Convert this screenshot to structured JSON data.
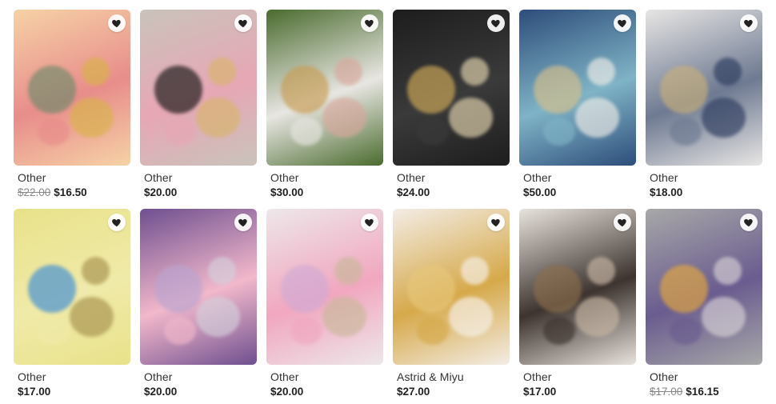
{
  "listings": [
    {
      "brand": "Other",
      "original_price": "$22.00",
      "price": "$16.50",
      "colors": [
        "#f6d2a6",
        "#e88d8b",
        "#6e8a6a",
        "#d8b34a"
      ]
    },
    {
      "brand": "Other",
      "original_price": "",
      "price": "$20.00",
      "colors": [
        "#c9c3bb",
        "#e7a7b5",
        "#141414",
        "#d8b56b"
      ]
    },
    {
      "brand": "Other",
      "original_price": "",
      "price": "$30.00",
      "colors": [
        "#4a6b2e",
        "#e8e6e2",
        "#c79b52",
        "#d8a79c"
      ]
    },
    {
      "brand": "Other",
      "original_price": "",
      "price": "$24.00",
      "colors": [
        "#1d1d1d",
        "#3a3a3a",
        "#d3ad5a",
        "#e6d7b2"
      ]
    },
    {
      "brand": "Other",
      "original_price": "",
      "price": "$50.00",
      "colors": [
        "#2d4d7a",
        "#7fb3c6",
        "#d9c08b",
        "#f1eee8"
      ]
    },
    {
      "brand": "Other",
      "original_price": "",
      "price": "$18.00",
      "colors": [
        "#e8e6e4",
        "#6e7a92",
        "#c8b07c",
        "#2c3b5e"
      ]
    },
    {
      "brand": "Other",
      "original_price": "",
      "price": "$17.00",
      "colors": [
        "#e8e28a",
        "#f0eaa9",
        "#3c8cd6",
        "#a6914e"
      ]
    },
    {
      "brand": "Other",
      "original_price": "",
      "price": "$20.00",
      "colors": [
        "#6e4f8f",
        "#f2b8cb",
        "#b9a4cf",
        "#d5d0dc"
      ]
    },
    {
      "brand": "Other",
      "original_price": "",
      "price": "$20.00",
      "colors": [
        "#ede7ea",
        "#f1a7bf",
        "#d0aad4",
        "#c9b89a"
      ]
    },
    {
      "brand": "Astrid & Miyu",
      "original_price": "",
      "price": "$27.00",
      "colors": [
        "#f3ede6",
        "#d6a94a",
        "#e7c77c",
        "#f7f2ec"
      ]
    },
    {
      "brand": "Other",
      "original_price": "",
      "price": "$17.00",
      "colors": [
        "#e9e3de",
        "#3d342f",
        "#8c6f4e",
        "#c9b9a6"
      ]
    },
    {
      "brand": "Other",
      "original_price": "$17.00",
      "price": "$16.15",
      "colors": [
        "#a8a8a8",
        "#6a5c8f",
        "#e6a93f",
        "#d8d2d6"
      ]
    }
  ]
}
